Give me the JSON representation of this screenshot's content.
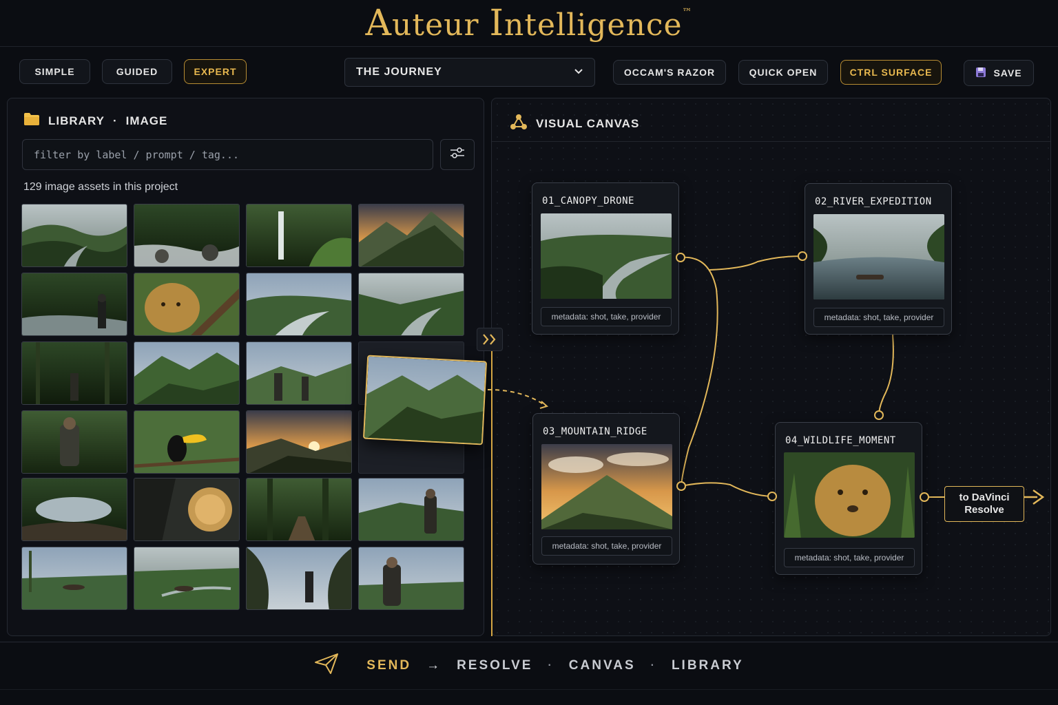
{
  "app": {
    "title_prefix_a": "A",
    "title_a": "uteur ",
    "title_prefix_i": "I",
    "title_i": "ntelligence",
    "tm": "™"
  },
  "toolbar": {
    "modes": [
      "SIMPLE",
      "GUIDED",
      "EXPERT"
    ],
    "active_mode": "EXPERT",
    "project_select": "THE JOURNEY",
    "occam": "OCCAM'S RAZOR",
    "quick_open": "QUICK OPEN",
    "ctrl_surface": "CTRL SURFACE",
    "save": "SAVE"
  },
  "library": {
    "heading": "LIBRARY",
    "separator": "·",
    "type": "IMAGE",
    "filter_placeholder": "filter by label / prompt / tag...",
    "count_text": "129 image assets in this project"
  },
  "canvas": {
    "heading": "VISUAL CANVAS",
    "nodes": [
      {
        "title": "01_CANOPY_DRONE",
        "meta": "metadata: shot, take, provider"
      },
      {
        "title": "02_RIVER_EXPEDITION",
        "meta": "metadata: shot, take, provider"
      },
      {
        "title": "03_MOUNTAIN_RIDGE",
        "meta": "metadata: shot, take, provider"
      },
      {
        "title": "04_WILDLIFE_MOMENT",
        "meta": "metadata: shot, take, provider"
      }
    ],
    "output_label_1": "to DaVinci",
    "output_label_2": "Resolve"
  },
  "footer": {
    "send": "SEND",
    "arrow": "→",
    "resolve": "RESOLVE",
    "dot": "·",
    "canvas": "CANVAS",
    "library": "LIBRARY"
  },
  "colors": {
    "accent": "#e3b85a",
    "background": "#0b0d12",
    "panel": "#0e1016"
  },
  "icons": [
    "folder-icon",
    "sliders-icon",
    "nodes-icon",
    "save-disk-icon",
    "chevron-down-icon",
    "paper-plane-icon",
    "collapse-chevron-icon"
  ]
}
